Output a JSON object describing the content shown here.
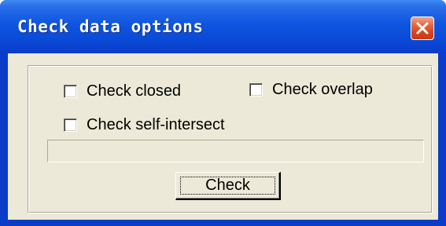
{
  "window": {
    "title": "Check data options",
    "close_icon": "close-icon",
    "colors": {
      "titlebar": "#0a4ad6",
      "close_button": "#d6431c",
      "client_background": "#ece9d8"
    }
  },
  "options": {
    "check_closed": {
      "label": "Check closed",
      "checked": false
    },
    "check_overlap": {
      "label": "Check overlap",
      "checked": false
    },
    "check_self_intersect": {
      "label": "Check self-intersect",
      "checked": false
    }
  },
  "progress": {
    "value": 0
  },
  "actions": {
    "check_label": "Check"
  }
}
